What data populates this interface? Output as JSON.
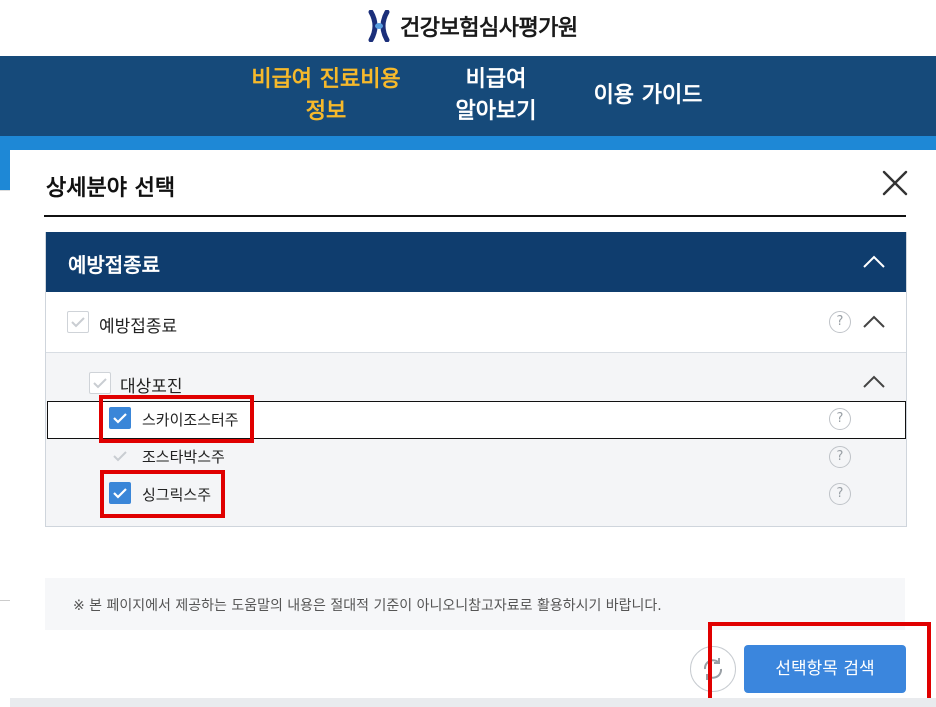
{
  "header": {
    "logo_text": "건강보험심사평가원"
  },
  "nav": {
    "items": [
      {
        "label_line1": "비급여 진료비용",
        "label_line2": "정보",
        "active": true
      },
      {
        "label_line1": "비급여",
        "label_line2": "알아보기",
        "active": false
      },
      {
        "label_line1": "이용 가이드",
        "label_line2": "",
        "active": false
      }
    ]
  },
  "modal": {
    "title": "상세분야 선택",
    "category": {
      "title": "예방접종료",
      "expanded": true
    },
    "tree": {
      "level1": {
        "label": "예방접종료",
        "checked": true
      },
      "level2": {
        "label": "대상포진",
        "checked": true
      },
      "items": [
        {
          "label": "스카이조스터주",
          "checked": true,
          "highlighted": true
        },
        {
          "label": "조스타박스주",
          "checked": true,
          "highlighted": false
        },
        {
          "label": "싱그릭스주",
          "checked": true,
          "highlighted": true
        }
      ]
    },
    "help_glyph": "?",
    "notice": "※ 본 페이지에서 제공하는 도움말의 내용은 절대적 기준이 아니오니참고자료로 활용하시기 바랍니다.",
    "search_button": "선택항목 검색"
  },
  "colors": {
    "nav_bg": "#164a7a",
    "nav_active": "#f6b92b",
    "accent_strip": "#1e88d6",
    "panel_header": "#0f3d6e",
    "checkbox_on": "#3a86d8",
    "button": "#3b86dd",
    "highlight": "#e00000"
  },
  "icons": [
    "logo-icon",
    "close-icon",
    "chevron-up-icon",
    "check-icon",
    "help-icon",
    "refresh-icon"
  ]
}
